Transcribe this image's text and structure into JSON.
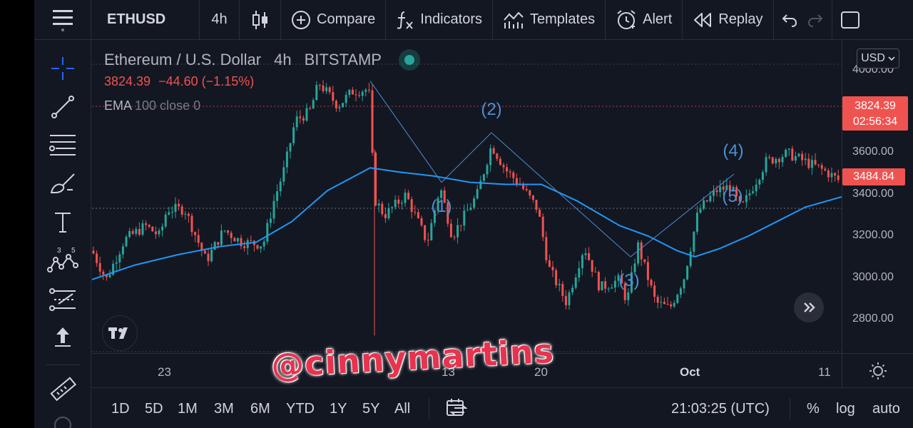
{
  "toolbar": {
    "symbol": "ETHUSD",
    "interval": "4h",
    "compare": "Compare",
    "indicators": "Indicators",
    "templates": "Templates",
    "alert": "Alert",
    "replay": "Replay"
  },
  "legend": {
    "title": "Ethereum / U.S. Dollar",
    "interval": "4h",
    "exchange": "BITSTAMP",
    "last_price": "3824.39",
    "change": "−44.60",
    "change_pct": "(−1.15%)",
    "ema_name": "EMA",
    "ema_params": "100 close 0"
  },
  "price_axis": {
    "currency": "USD",
    "top_label": "4000.00",
    "labels": [
      "3600.00",
      "3400.00",
      "3200.00",
      "3000.00",
      "2800.00"
    ],
    "last_price": "3824.39",
    "countdown": "02:56:34",
    "ema_value": "3484.84"
  },
  "time_axis": {
    "labels": [
      "23",
      "13",
      "20",
      "Oct",
      "11"
    ]
  },
  "bottombar": {
    "ranges": [
      "1D",
      "5D",
      "1M",
      "3M",
      "6M",
      "YTD",
      "1Y",
      "5Y",
      "All"
    ],
    "clock": "21:03:25 (UTC)",
    "percent": "%",
    "log": "log",
    "auto": "auto"
  },
  "annotations": {
    "wave1": "(1)",
    "wave2": "(2)",
    "wave3": "(3)",
    "wave4": "(4)",
    "wave5": "(5)"
  },
  "watermark": "@cinnymartins",
  "colors": {
    "background": "#131722",
    "up": "#26a69a",
    "down": "#ef5350",
    "ema": "#2196f3",
    "wave": "#4c8fd6"
  },
  "chart_data": {
    "type": "candlestick",
    "symbol": "ETHUSD",
    "x_ticks": [
      "23",
      "13",
      "20",
      "Oct",
      "11"
    ],
    "ylim": [
      2650,
      4050
    ],
    "y_ticks": [
      2800,
      3000,
      3200,
      3400,
      3600
    ],
    "wave_points": [
      {
        "label": "",
        "price": 3950
      },
      {
        "label": "(1)",
        "price": 3460
      },
      {
        "label": "(2)",
        "price": 3700
      },
      {
        "label": "(3)",
        "price": 3100
      },
      {
        "label": "(4)",
        "price": 3500
      }
    ],
    "ema_value": 3484.84,
    "last_close": 3824.39
  }
}
